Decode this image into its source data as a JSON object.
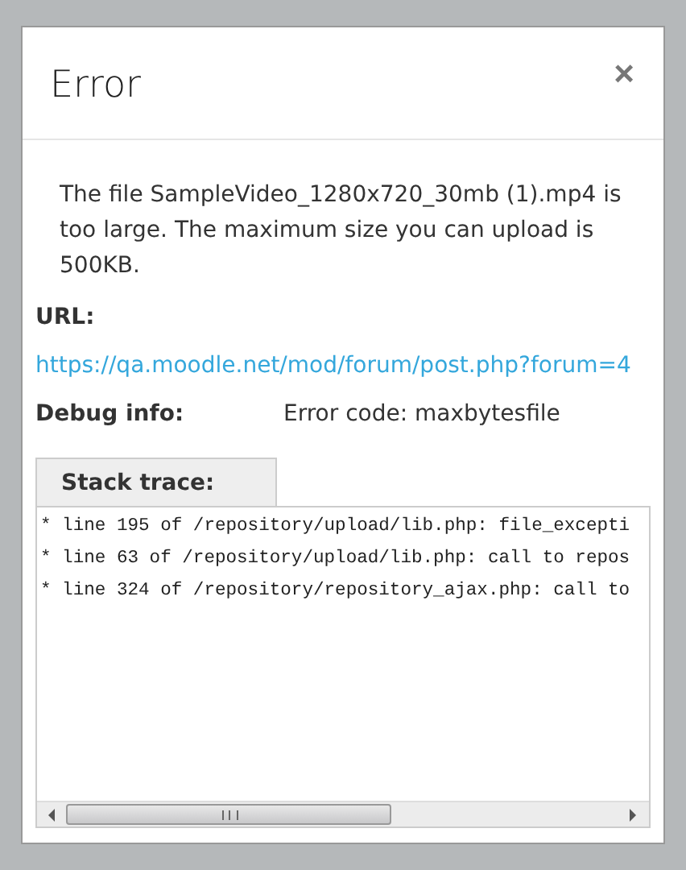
{
  "dialog": {
    "title": "Error",
    "close": "×",
    "message": "The file SampleVideo_1280x720_30mb (1).mp4 is too large. The maximum size you can upload is 500KB.",
    "fields": [
      {
        "label": "URL:",
        "value": "https://qa.moodle.net/mod/forum/post.php?forum=4",
        "kind": "link"
      },
      {
        "label": "Debug info:",
        "value": "Error code: maxbytesfile",
        "kind": "text"
      }
    ],
    "stack_trace": {
      "label": "Stack trace:",
      "lines": [
        "* line 195 of /repository/upload/lib.php: file_excepti",
        "* line 63 of /repository/upload/lib.php: call to repos",
        "* line 324 of /repository/repository_ajax.php: call to"
      ]
    }
  }
}
